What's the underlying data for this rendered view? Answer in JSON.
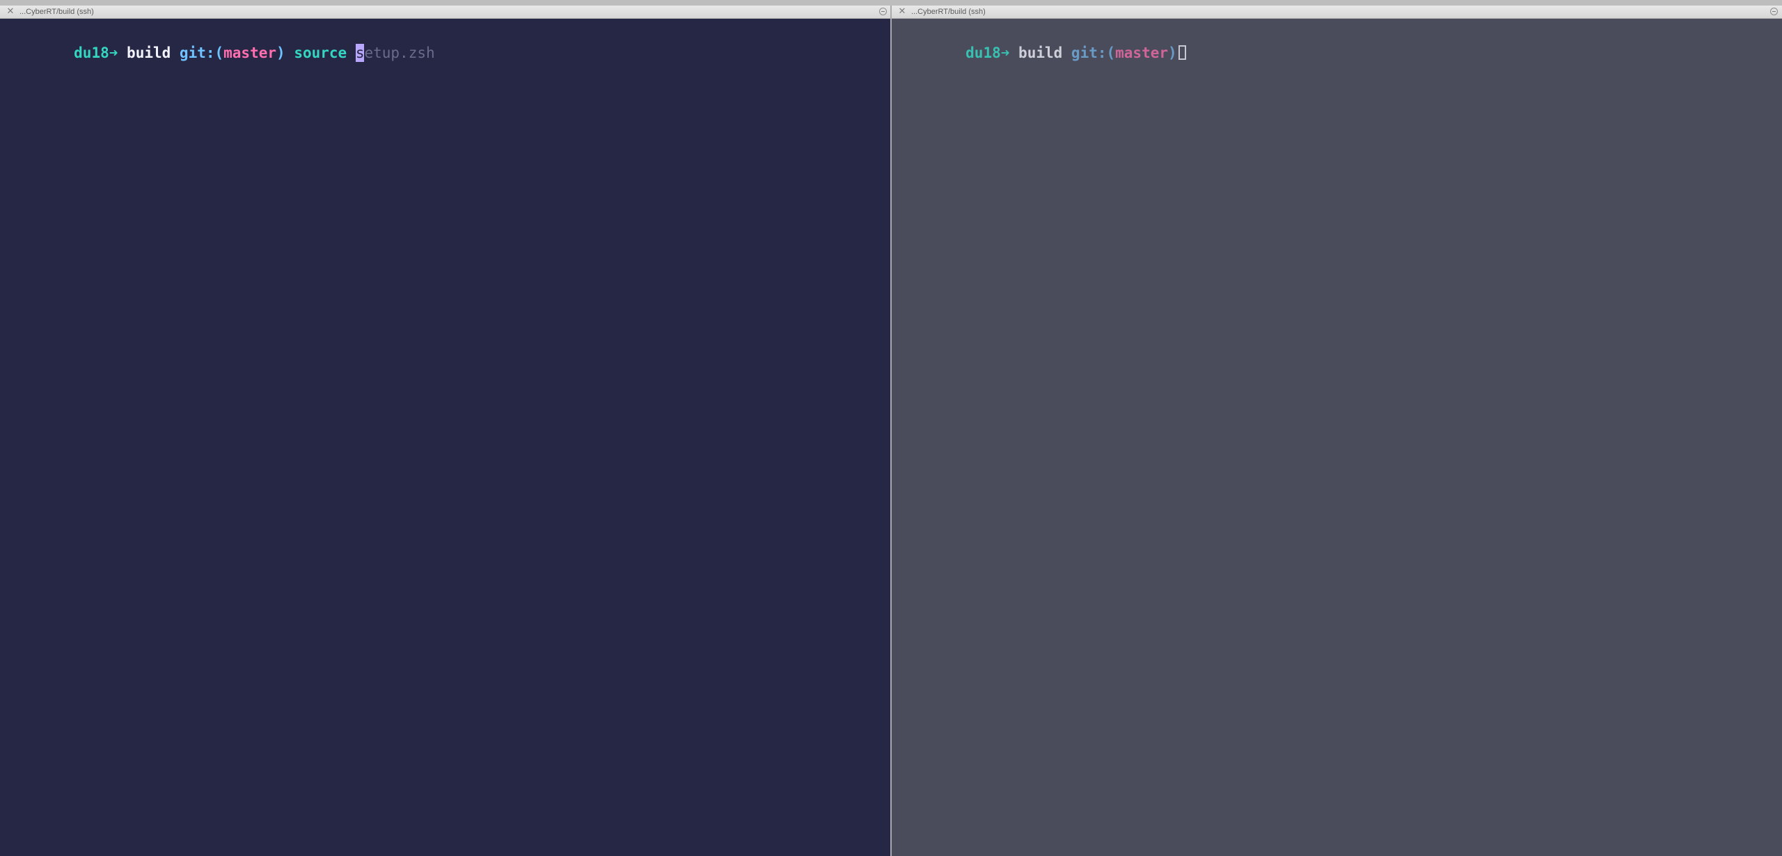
{
  "panes": [
    {
      "title": "...CyberRT/build (ssh)",
      "prompt": {
        "host": "du18",
        "arrow": "➜",
        "dir": "build",
        "git_prefix": "git:(",
        "branch": "master",
        "git_suffix": ")",
        "command": "source",
        "cursor_char": "s",
        "suggestion": "etup.zsh"
      }
    },
    {
      "title": "...CyberRT/build (ssh)",
      "prompt": {
        "host": "du18",
        "arrow": "➜",
        "dir": "build",
        "git_prefix": "git:(",
        "branch": "master",
        "git_suffix": ")"
      }
    }
  ],
  "colors": {
    "left_bg": "#262745",
    "right_bg": "#4a4c5b",
    "host": "#35d6c1",
    "dir": "#f4f4ff",
    "git": "#6fc3ff",
    "branch": "#ff6fb0",
    "command": "#35d6c1",
    "suggestion": "#6a6b8c",
    "cursor": "#b9a6ff"
  },
  "icons": {
    "close": "close-x-icon",
    "minimize": "minus-circle-icon"
  }
}
